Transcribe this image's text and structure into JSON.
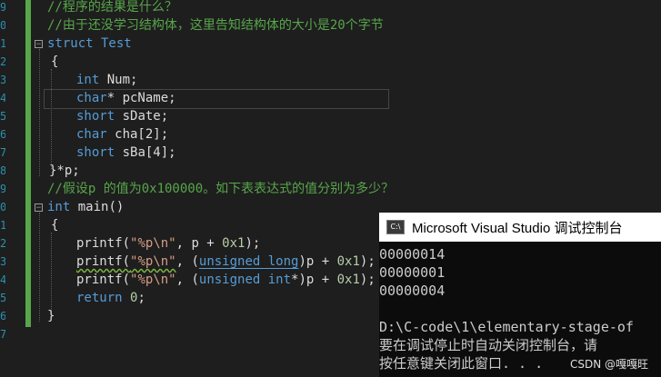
{
  "editor": {
    "line_numbers": [
      "9",
      "0",
      "1",
      "2",
      "3",
      "4",
      "5",
      "6",
      "7",
      "8",
      "9",
      "0",
      "1",
      "2",
      "3",
      "4",
      "5",
      "6",
      "7"
    ],
    "lines": {
      "l0": "//程序的结果是什么？",
      "l1": "//由于还没学习结构体，这里告知结构体的大小是20个字节",
      "l2_kw": "struct",
      "l2_name": " Test",
      "l3": "{",
      "l4_kw": "int",
      "l4_txt": " Num;",
      "l5_kw": "char",
      "l5_txt": "* pcName;",
      "l6_kw": "short",
      "l6_txt": " sDate;",
      "l7_kw": "char",
      "l7_txt": " cha[2];",
      "l8_kw": "short",
      "l8_txt": " sBa[4];",
      "l9": "}*p;",
      "l10": "//假设p 的值为0x100000。如下表表达式的值分别为多少？",
      "l11_kw": "int",
      "l11_txt": " main()",
      "l12": "{",
      "l13_a": "printf(",
      "l13_s": "\"%p\\n\"",
      "l13_b": ", p + ",
      "l13_n": "0x1",
      "l13_c": ");",
      "l14_a": "printf(",
      "l14_s": "\"%p\\n\"",
      "l14_b": ", (",
      "l14_kw": "unsigned long",
      "l14_c": ")p + ",
      "l14_n": "0x1",
      "l14_d": ");",
      "l15_a": "printf(",
      "l15_s": "\"%p\\n\"",
      "l15_b": ", (",
      "l15_kw": "unsigned int",
      "l15_c": "*)p + ",
      "l15_n": "0x1",
      "l15_d": ");",
      "l16_kw": "return",
      "l16_n": " 0",
      "l16_t": ";",
      "l17": "}"
    }
  },
  "console": {
    "title": "Microsoft Visual Studio 调试控制台",
    "icon": "console-app-icon",
    "output": [
      "00000014",
      "00000001",
      "00000004",
      "",
      "D:\\C-code\\1\\elementary-stage-of",
      "要在调试停止时自动关闭控制台，请",
      "按任意键关闭此窗口. . ."
    ]
  },
  "watermark": "CSDN @嘎嘎旺",
  "colors": {
    "keyword": "#569cd6",
    "comment": "#57a64a",
    "string": "#d69d85",
    "background": "#1e1e1e"
  }
}
